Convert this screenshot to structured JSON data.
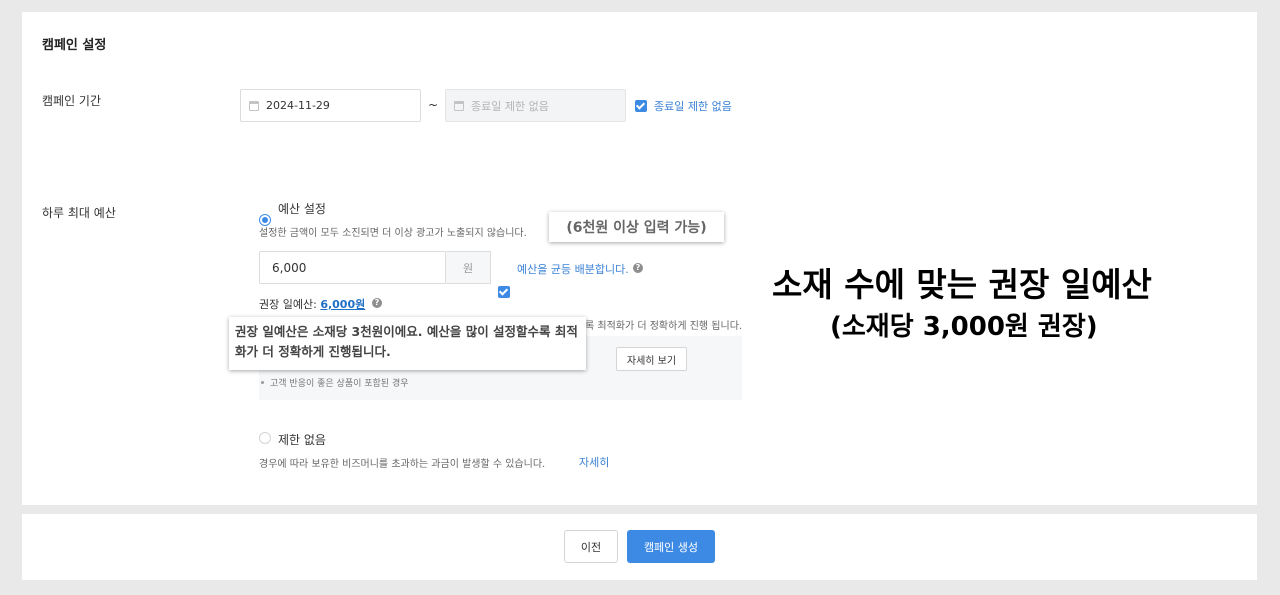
{
  "section": {
    "title": "캠페인 설정"
  },
  "period": {
    "label": "캠페인 기간",
    "start_value": "2024-11-29",
    "separator": "~",
    "end_placeholder": "종료일 제한 없음",
    "no_end_checkbox_label": "종료일 제한 없음",
    "no_end_checked": true
  },
  "budget": {
    "label": "하루 최대 예산",
    "option_set_label": "예산 설정",
    "option_set_desc": "설정한 금액이 모두 소진되면 더 이상 광고가 노출되지 않습니다.",
    "callout_min": "(6천원 이상 입력 가능)",
    "amount_value": "6,000",
    "unit": "원",
    "even_distribution_label": "예산을 균등 배분합니다.",
    "even_distribution_checked": true,
    "help_icon": "?",
    "recommended_prefix": "권장 일예산: ",
    "recommended_value": "6,000원",
    "recommended_tail_text": "록 최적화가 더 정확하게 진행 됩니다.",
    "info_bullet": "고객 반응이 좋은 상품이 포함된 경우",
    "detail_button": "자세히 보기",
    "callout_recommend": "권장 일예산은 소재당 3천원이에요. 예산을 많이 설정할수록 최적화가 더 정확하게 진행됩니다.",
    "option_unlimited_label": "제한 없음",
    "option_unlimited_desc": "경우에 따라 보유한 비즈머니를 초과하는 과금이 발생할 수 있습니다.",
    "detail_link": "자세히",
    "selected_option": "예산 설정"
  },
  "overlay": {
    "title": "소재 수에 맞는 권장 일예산",
    "subtitle": "(소재당 3,000원 권장)"
  },
  "footer": {
    "prev_label": "이전",
    "create_label": "캠페인 생성"
  },
  "colors": {
    "accent": "#3d8ae5",
    "link": "#3b82d6"
  },
  "icons": {
    "calendar": "calendar-icon",
    "help": "help-icon"
  }
}
